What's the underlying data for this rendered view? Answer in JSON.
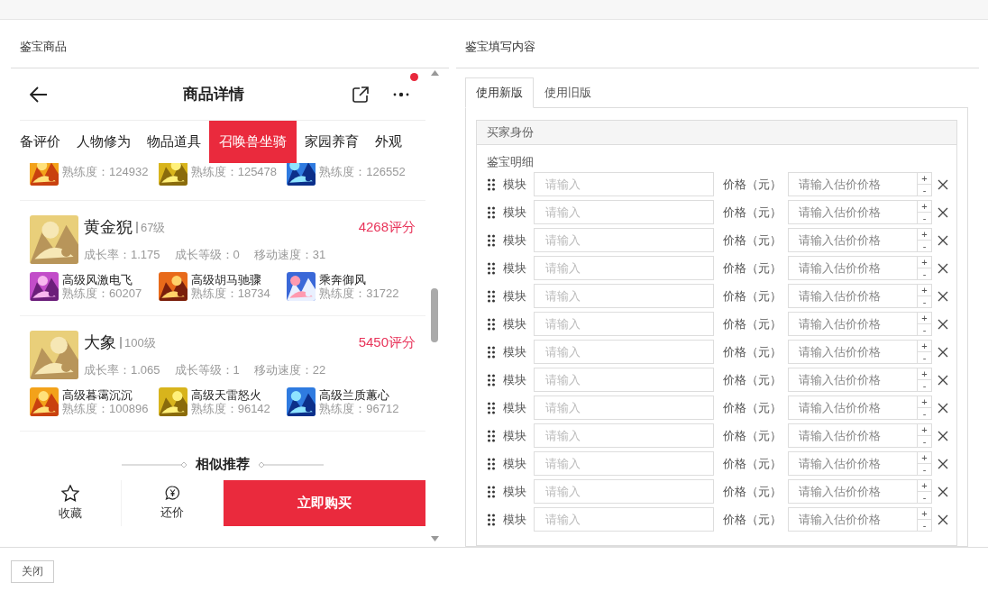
{
  "left_panel": {
    "title": "鉴宝商品"
  },
  "phone": {
    "title": "商品详情",
    "has_notification": true,
    "tabs": [
      {
        "label": "备评价",
        "selected": false
      },
      {
        "label": "人物修为",
        "selected": false
      },
      {
        "label": "物品道具",
        "selected": false
      },
      {
        "label": "召唤兽坐骑",
        "selected": true
      },
      {
        "label": "家园养育",
        "selected": false
      },
      {
        "label": "外观",
        "selected": false
      }
    ],
    "pets": [
      {
        "kind": "partial",
        "skills": [
          {
            "proficiency": "熟练度：124932"
          },
          {
            "proficiency": "熟练度：125478"
          },
          {
            "proficiency": "熟练度：126552"
          }
        ]
      },
      {
        "kind": "full",
        "name": "黄金猊",
        "level": "67级",
        "score": "4268评分",
        "stats": [
          "成长率：1.175",
          "成长等级：0",
          "移动速度：31"
        ],
        "skills": [
          {
            "name": "高级风激电飞",
            "proficiency": "熟练度：60207"
          },
          {
            "name": "高级胡马驰骤",
            "proficiency": "熟练度：18734"
          },
          {
            "name": "乘奔御风",
            "proficiency": "熟练度：31722"
          }
        ]
      },
      {
        "kind": "full",
        "name": "大象",
        "level": "100级",
        "score": "5450评分",
        "stats": [
          "成长率：1.065",
          "成长等级：1",
          "移动速度：22"
        ],
        "skills": [
          {
            "name": "高级暮霭沉沉",
            "proficiency": "熟练度：100896"
          },
          {
            "name": "高级天雷怒火",
            "proficiency": "熟练度：96142"
          },
          {
            "name": "高级兰质蕙心",
            "proficiency": "熟练度：96712"
          }
        ]
      }
    ],
    "section_title": "相似推荐",
    "actions": [
      {
        "kind": "favorite",
        "label": "收藏"
      },
      {
        "kind": "bargain",
        "label": "还价"
      }
    ],
    "buy_button": "立即购买"
  },
  "right_panel": {
    "title": "鉴宝填写内容",
    "tabs": [
      {
        "label": "使用新版",
        "selected": true
      },
      {
        "label": "使用旧版",
        "selected": false
      }
    ],
    "section_header": "买家身份",
    "detail_label": "鉴宝明细",
    "rows": [
      {
        "label": "模块",
        "placeholder": "请输入",
        "price_label": "价格（元）",
        "price_placeholder": "请输入估价价格",
        "plus": "+",
        "minus": "-"
      },
      {
        "label": "模块",
        "placeholder": "请输入",
        "price_label": "价格（元）",
        "price_placeholder": "请输入估价价格",
        "plus": "+",
        "minus": "-"
      },
      {
        "label": "模块",
        "placeholder": "请输入",
        "price_label": "价格（元）",
        "price_placeholder": "请输入估价价格",
        "plus": "+",
        "minus": "-"
      },
      {
        "label": "模块",
        "placeholder": "请输入",
        "price_label": "价格（元）",
        "price_placeholder": "请输入估价价格",
        "plus": "+",
        "minus": "-"
      },
      {
        "label": "模块",
        "placeholder": "请输入",
        "price_label": "价格（元）",
        "price_placeholder": "请输入估价价格",
        "plus": "+",
        "minus": "-"
      },
      {
        "label": "模块",
        "placeholder": "请输入",
        "price_label": "价格（元）",
        "price_placeholder": "请输入估价价格",
        "plus": "+",
        "minus": "-"
      },
      {
        "label": "模块",
        "placeholder": "请输入",
        "price_label": "价格（元）",
        "price_placeholder": "请输入估价价格",
        "plus": "+",
        "minus": "-"
      },
      {
        "label": "模块",
        "placeholder": "请输入",
        "price_label": "价格（元）",
        "price_placeholder": "请输入估价价格",
        "plus": "+",
        "minus": "-"
      },
      {
        "label": "模块",
        "placeholder": "请输入",
        "price_label": "价格（元）",
        "price_placeholder": "请输入估价价格",
        "plus": "+",
        "minus": "-"
      },
      {
        "label": "模块",
        "placeholder": "请输入",
        "price_label": "价格（元）",
        "price_placeholder": "请输入估价价格",
        "plus": "+",
        "minus": "-"
      },
      {
        "label": "模块",
        "placeholder": "请输入",
        "price_label": "价格（元）",
        "price_placeholder": "请输入估价价格",
        "plus": "+",
        "minus": "-"
      },
      {
        "label": "模块",
        "placeholder": "请输入",
        "price_label": "价格（元）",
        "price_placeholder": "请输入估价价格",
        "plus": "+",
        "minus": "-"
      },
      {
        "label": "模块",
        "placeholder": "请输入",
        "price_label": "价格（元）",
        "price_placeholder": "请输入估价价格",
        "plus": "+",
        "minus": "-"
      }
    ]
  },
  "footer": {
    "close_button": "关闭"
  }
}
